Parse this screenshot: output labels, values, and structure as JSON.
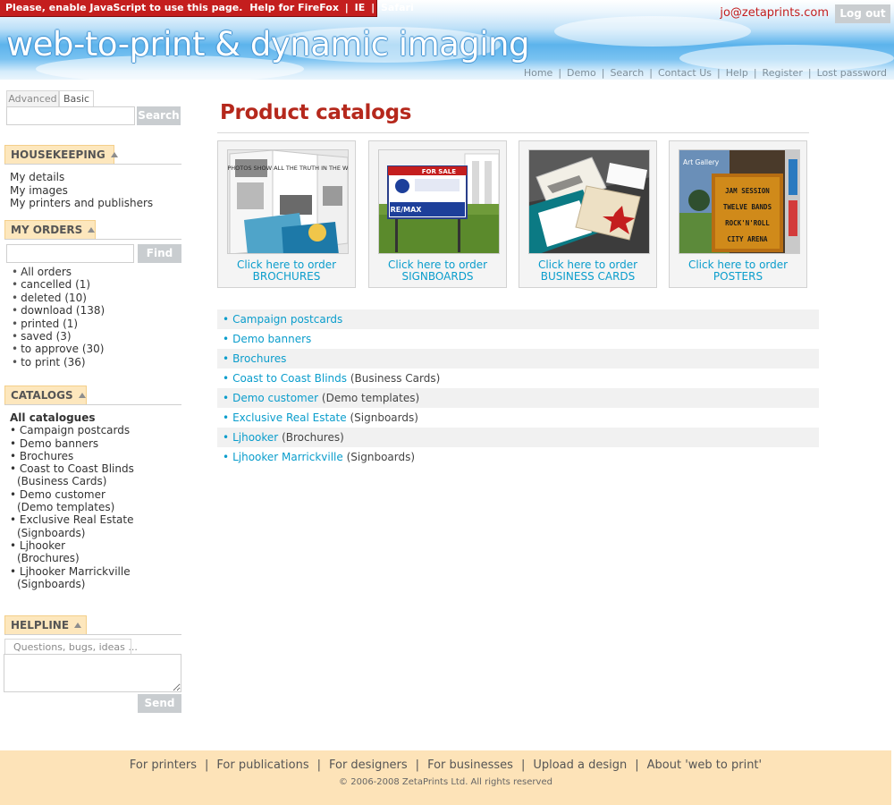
{
  "warning": {
    "text": "Please, enable JavaScript to use this page.",
    "help_prefix": "Help for",
    "links": [
      "FireFox",
      "IE",
      "Safari"
    ]
  },
  "header": {
    "email": "jo@zetaprints.com",
    "logout_label": "Log out",
    "site_title": "web-to-print & dynamic imaging",
    "nav": [
      "Home",
      "Demo",
      "Search",
      "Contact Us",
      "Help",
      "Register",
      "Lost password"
    ]
  },
  "search": {
    "tabs": [
      "Advanced",
      "Basic"
    ],
    "button_label": "Search"
  },
  "housekeeping": {
    "heading": "HOUSEKEEPING",
    "items": [
      "My details",
      "My images",
      "My printers and publishers"
    ]
  },
  "orders": {
    "heading": "MY ORDERS",
    "find_label": "Find",
    "items": [
      "All orders",
      "cancelled (1)",
      "deleted (10)",
      "download (138)",
      "printed (1)",
      "saved (3)",
      "to approve (30)",
      "to print (36)"
    ]
  },
  "catalogs_side": {
    "heading": "CATALOGS",
    "all_label": "All catalogues",
    "items": [
      {
        "name": "Campaign postcards",
        "sub": ""
      },
      {
        "name": "Demo banners",
        "sub": ""
      },
      {
        "name": "Brochures",
        "sub": ""
      },
      {
        "name": "Coast to Coast Blinds",
        "sub": "(Business Cards)"
      },
      {
        "name": "Demo customer",
        "sub": "(Demo templates)"
      },
      {
        "name": "Exclusive Real Estate",
        "sub": "(Signboards)"
      },
      {
        "name": "Ljhooker",
        "sub": "(Brochures)"
      },
      {
        "name": "Ljhooker Marrickville",
        "sub": "(Signboards)"
      }
    ]
  },
  "helpline": {
    "heading": "HELPLINE",
    "placeholder": "Questions, bugs, ideas ...",
    "send_label": "Send"
  },
  "main": {
    "title": "Product catalogs",
    "products": [
      {
        "line1": "Click here to order",
        "line2": "BROCHURES"
      },
      {
        "line1": "Click here to order",
        "line2": "SIGNBOARDS"
      },
      {
        "line1": "Click here to order",
        "line2": "BUSINESS CARDS"
      },
      {
        "line1": "Click here to order",
        "line2": "POSTERS"
      }
    ],
    "catalog_rows": [
      {
        "name": "Campaign postcards",
        "note": ""
      },
      {
        "name": "Demo banners",
        "note": ""
      },
      {
        "name": "Brochures",
        "note": ""
      },
      {
        "name": "Coast to Coast Blinds",
        "note": "(Business Cards)"
      },
      {
        "name": "Demo customer",
        "note": "(Demo templates)"
      },
      {
        "name": "Exclusive Real Estate",
        "note": "(Signboards)"
      },
      {
        "name": "Ljhooker",
        "note": "(Brochures)"
      },
      {
        "name": "Ljhooker Marrickville",
        "note": "(Signboards)"
      }
    ],
    "thumb_text": {
      "brochure": "PHOTOS SHOW ALL THE TRUTH IN THE WORLD",
      "sign_forsale": "FOR SALE",
      "sign_brand": "RE/MAX",
      "poster_gallery": "Art Gallery",
      "poster_lines": [
        "JAM SESSION",
        "TWELVE BANDS",
        "ROCK'N'ROLL",
        "CITY ARENA"
      ]
    }
  },
  "footer": {
    "links": [
      "For printers",
      "For publications",
      "For designers",
      "For businesses",
      "Upload a design",
      "About 'web to print'"
    ],
    "copyright": "© 2006-2008 ZetaPrints Ltd. All rights reserved"
  },
  "colors": {
    "accent_red": "#b5281c",
    "link_blue": "#0a9dcc",
    "side_head_bg": "#fde7bd",
    "footer_bg": "#fde3b8",
    "button_gray": "#c9cdd0"
  }
}
